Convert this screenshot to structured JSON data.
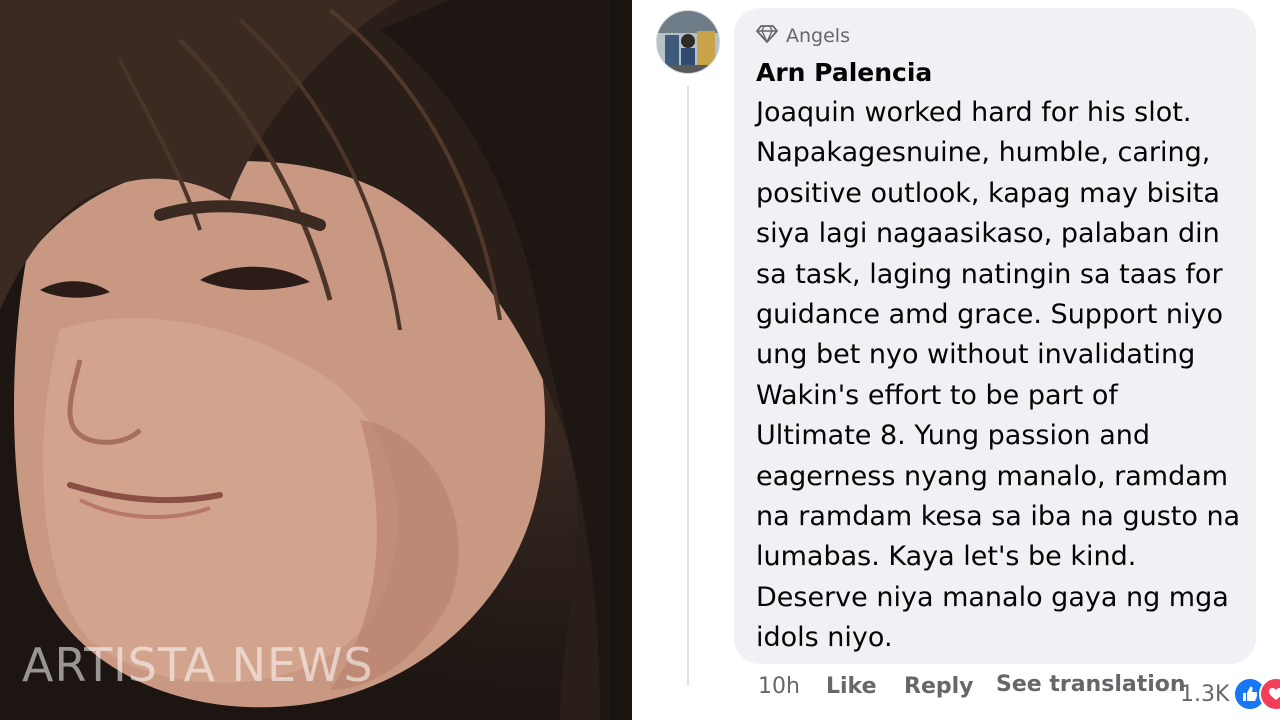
{
  "photo": {
    "watermark": "ARTISTA NEWS"
  },
  "comment": {
    "badge_icon": "diamond-icon",
    "badge_label": "Angels",
    "author": "Arn Palencia",
    "lines": [
      "Joaquin worked hard for his slot.",
      "Napakagesnuine, humble, caring,",
      "positive outlook, kapag may bisita",
      "siya lagi nagaasikaso, palaban din",
      "sa task, laging natingin sa taas for",
      "guidance amd grace. Support niyo",
      "ung bet nyo without invalidating",
      "Wakin's effort to be part of",
      "Ultimate 8. Yung passion and",
      "eagerness nyang manalo, ramdam",
      "na ramdam kesa sa iba na gusto na",
      "lumabas. Kaya let's be kind.",
      "Deserve niya manalo gaya ng mga",
      "idols niyo."
    ]
  },
  "actions": {
    "time": "10h",
    "like": "Like",
    "reply": "Reply",
    "translate": "See translation"
  },
  "reactions": {
    "count": "1.3K",
    "icons": [
      "like-icon",
      "heart-icon"
    ],
    "colors": {
      "like": "#1877f2",
      "heart": "#f33e58"
    }
  },
  "colors": {
    "bubble": "#eff1f4",
    "meta_text": "#65676b",
    "body_text": "#050505"
  }
}
